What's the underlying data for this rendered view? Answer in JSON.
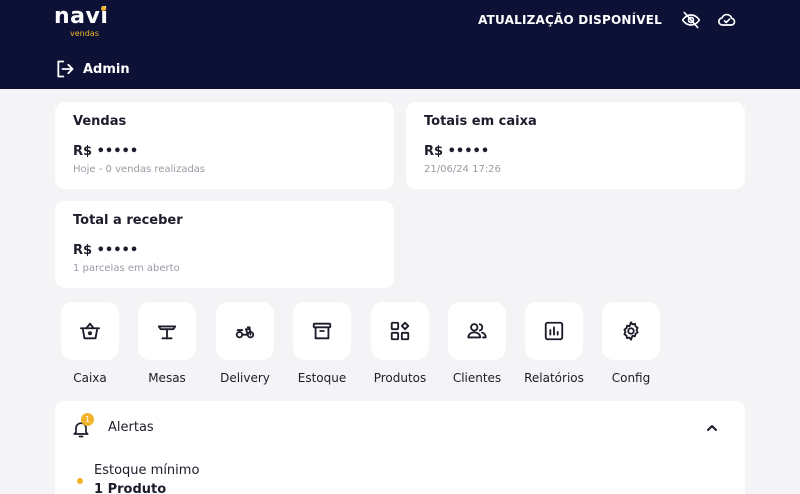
{
  "header": {
    "logo_main": "navi",
    "logo_sub": "vendas",
    "update_text": "ATUALIZAÇÃO DISPONÍVEL",
    "user_label": "Admin",
    "icons": [
      "eye-off-icon",
      "cloud-check-icon",
      "logout-icon"
    ]
  },
  "cards": {
    "vendas": {
      "title": "Vendas",
      "value": "R$ •••••",
      "sub": "Hoje - 0 vendas realizadas"
    },
    "caixa": {
      "title": "Totais em caixa",
      "value": "R$ •••••",
      "sub": "21/06/24 17:26"
    },
    "receber": {
      "title": "Total a receber",
      "value": "R$ •••••",
      "sub": "1 parcelas em aberto"
    }
  },
  "shortcuts": [
    {
      "label": "Caixa",
      "icon": "basket-icon"
    },
    {
      "label": "Mesas",
      "icon": "table-icon"
    },
    {
      "label": "Delivery",
      "icon": "scooter-icon"
    },
    {
      "label": "Estoque",
      "icon": "archive-icon"
    },
    {
      "label": "Produtos",
      "icon": "grid-plus-icon"
    },
    {
      "label": "Clientes",
      "icon": "users-icon"
    },
    {
      "label": "Relatórios",
      "icon": "bar-chart-icon"
    },
    {
      "label": "Config",
      "icon": "gear-icon"
    }
  ],
  "alerts": {
    "title": "Alertas",
    "badge_count": "1",
    "items": [
      {
        "label": "Estoque mínimo",
        "value": "1 Produto"
      }
    ]
  },
  "colors": {
    "header_bg": "#0d1136",
    "accent": "#f2b32a",
    "card_bg": "#ffffff",
    "page_bg": "#f4f4f6"
  }
}
